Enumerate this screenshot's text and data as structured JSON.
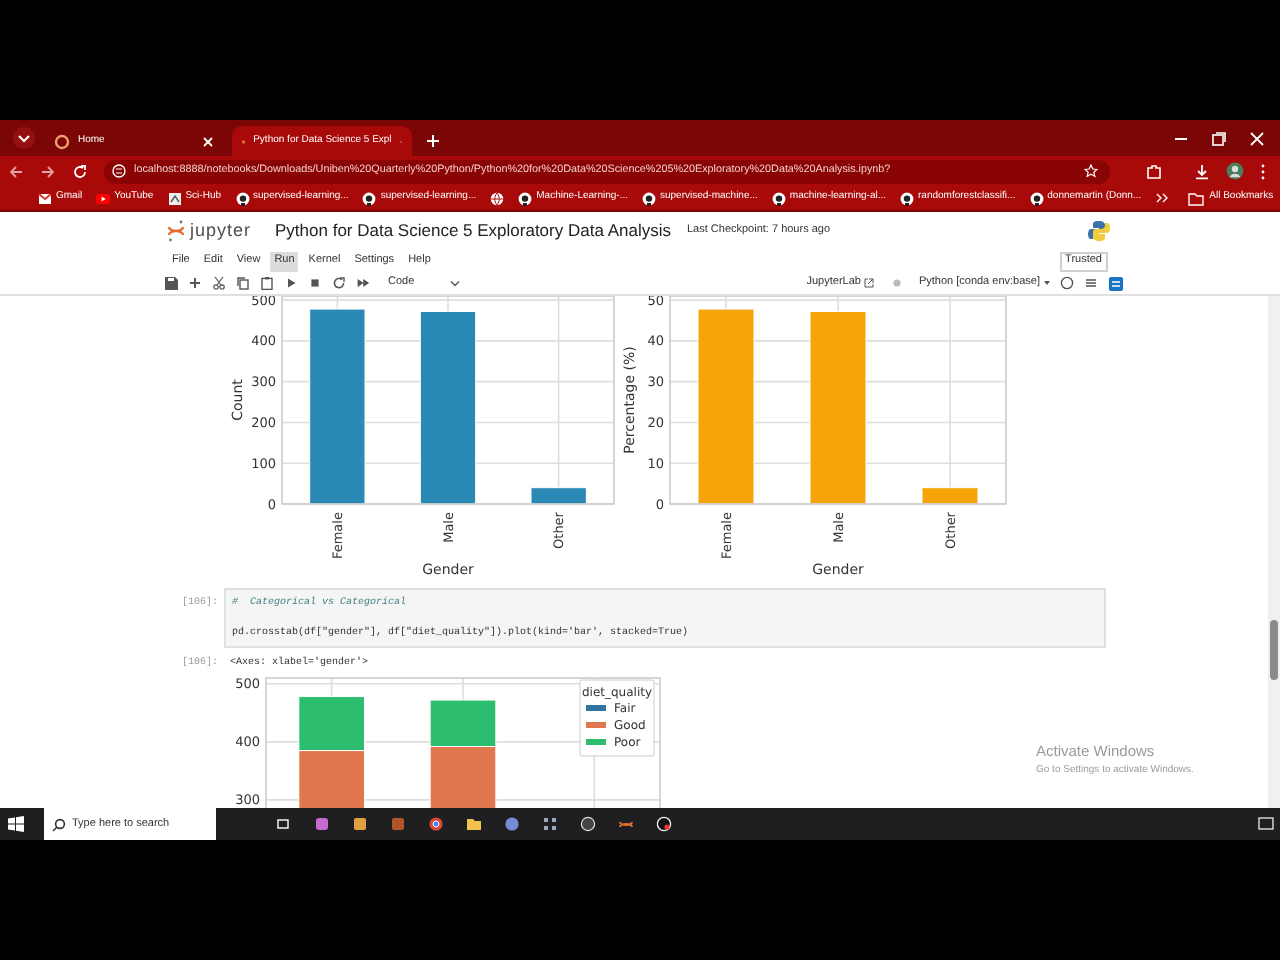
{
  "browser": {
    "tabs": [
      {
        "label": "Home",
        "selected": false
      },
      {
        "label": "Python for Data Science 5 Expl",
        "selected": true
      }
    ],
    "address": "localhost:8888/notebooks/Downloads/Uniben%20Quarterly%20Python/Python%20for%20Data%20Science%205%20Exploratory%20Data%20Analysis.ipynb?",
    "bookmarks": [
      {
        "kind": "gmail",
        "label": "Gmail"
      },
      {
        "kind": "youtube",
        "label": "YouTube"
      },
      {
        "kind": "scihub",
        "label": "Sci-Hub"
      },
      {
        "kind": "github",
        "label": "supervised-learning..."
      },
      {
        "kind": "github",
        "label": "supervised-learning..."
      },
      {
        "kind": "globe"
      },
      {
        "kind": "github",
        "label": "Machine-Learning-..."
      },
      {
        "kind": "github",
        "label": "supervised-machine..."
      },
      {
        "kind": "github",
        "label": "machine-learning-al..."
      },
      {
        "kind": "github",
        "label": "randomforestclassifi..."
      },
      {
        "kind": "github",
        "label": "donnemartin (Donn..."
      }
    ],
    "all_bookmarks": "All Bookmarks"
  },
  "notebook": {
    "logo": "jupyter",
    "title": "Python for Data Science 5 Exploratory Data Analysis",
    "checkpoint": "Last Checkpoint: 7 hours ago",
    "menu": [
      {
        "label": "File",
        "selected": false
      },
      {
        "label": "Edit",
        "selected": false
      },
      {
        "label": "View",
        "selected": false
      },
      {
        "label": "Run",
        "selected": true
      },
      {
        "label": "Kernel",
        "selected": false
      },
      {
        "label": "Settings",
        "selected": false
      },
      {
        "label": "Help",
        "selected": false
      }
    ],
    "trusted": "Trusted",
    "cell_type": "Code",
    "jupyterlab": "JupyterLab",
    "kernel": "Python [conda env:base]",
    "charts_top": [
      {
        "chart_data": {
          "type": "bar",
          "xlabel": "Gender",
          "ylabel": "Count",
          "categories": [
            "Female",
            "Male",
            "Other"
          ],
          "values": [
            478,
            472,
            40
          ],
          "grid": true,
          "ylim": [
            0,
            510
          ],
          "yticks": [
            0,
            100,
            200,
            300,
            400,
            500
          ],
          "color": "#2a8ab5"
        }
      },
      {
        "chart_data": {
          "type": "bar",
          "xlabel": "Gender",
          "ylabel": "Percentage (%)",
          "categories": [
            "Female",
            "Male",
            "Other"
          ],
          "values": [
            47.8,
            47.2,
            4.0
          ],
          "grid": true,
          "ylim": [
            0,
            51
          ],
          "yticks": [
            0,
            10,
            20,
            30,
            40,
            50
          ],
          "color": "#f5a50a"
        }
      }
    ],
    "code_cell": {
      "prompt": "[106]:",
      "lines": [
        {
          "kind": "comment",
          "text": "#  Categorical vs Categorical"
        },
        {
          "kind": "code",
          "text": "pd.crosstab(df[\"gender\"], df[\"diet_quality\"]).plot(kind='bar', stacked=True)"
        }
      ]
    },
    "output": {
      "prompt": "[106]:",
      "text": "<Axes: xlabel='gender'>",
      "chart_data": {
        "type": "bar",
        "stacked": true,
        "grid": true,
        "ylim": [
          0,
          510
        ],
        "yticks": [
          300,
          400,
          500
        ],
        "series": [
          {
            "name": "Fair",
            "color": "#3274a1",
            "values": [
              null,
              null,
              null
            ]
          },
          {
            "name": "Good",
            "color": "#e1774e",
            "values": [
              385,
              392,
              null
            ]
          },
          {
            "name": "Poor",
            "color": "#2dbd6e",
            "values": [
              93,
              80,
              null
            ]
          }
        ],
        "legend": {
          "title": "diet_quality"
        }
      }
    }
  },
  "activate_windows": {
    "title": "Activate Windows",
    "subtitle": "Go to Settings to activate Windows."
  },
  "taskbar": {
    "search_placeholder": "Type here to search"
  }
}
